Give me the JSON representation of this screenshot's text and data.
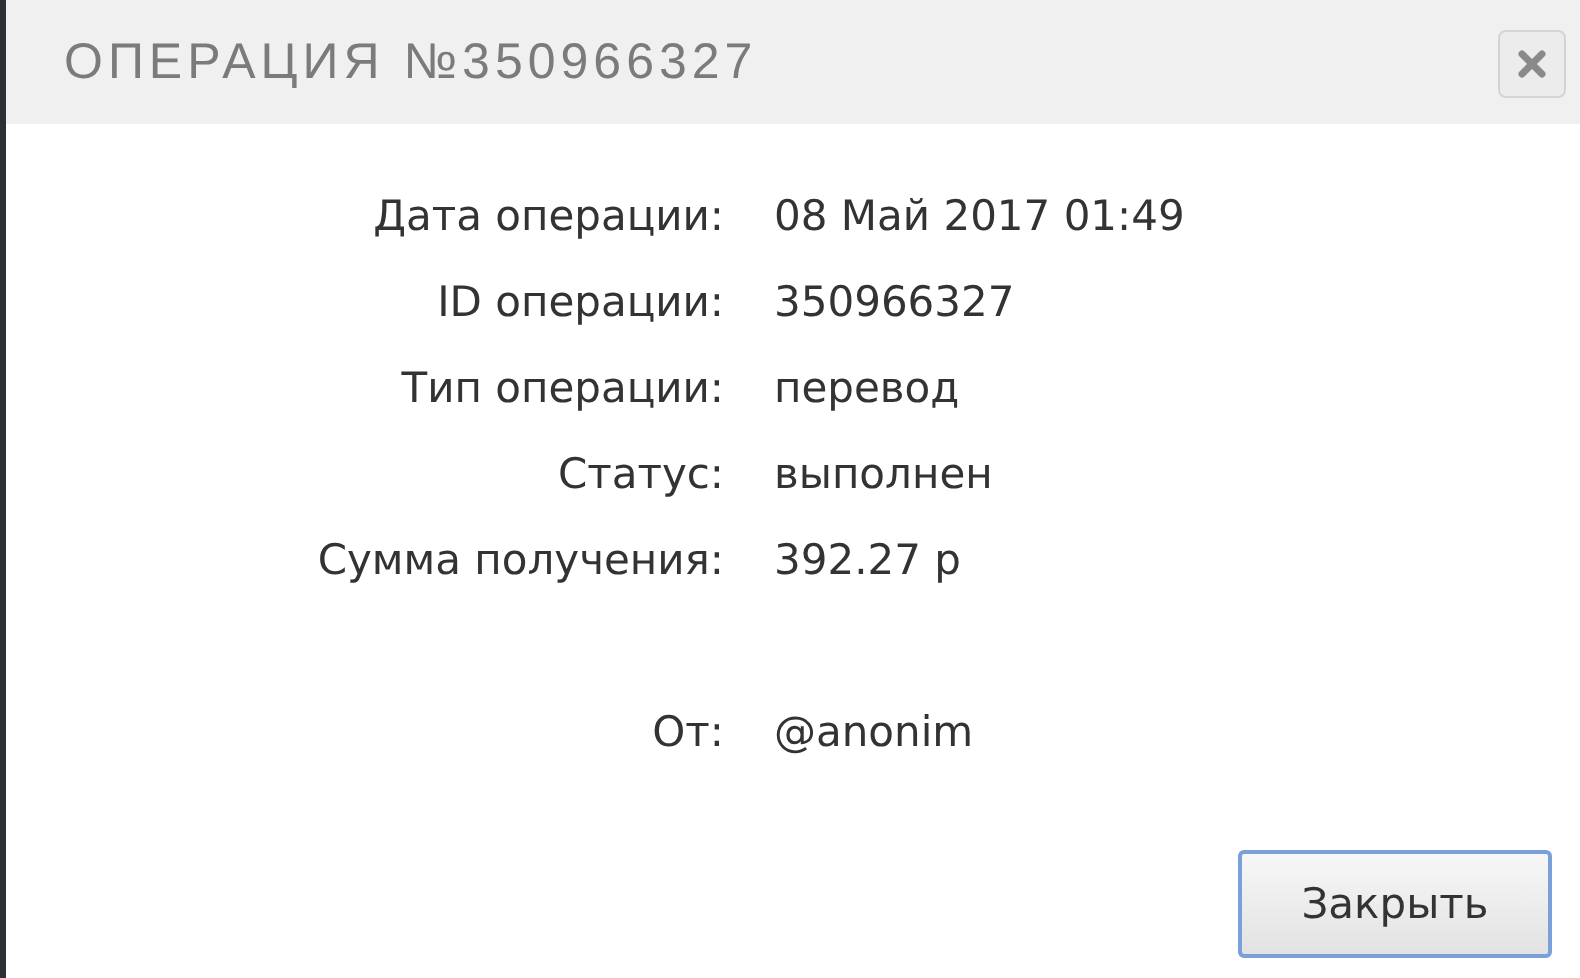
{
  "dialog": {
    "title": "ОПЕРАЦИЯ №350966327"
  },
  "details": [
    {
      "kind": "field",
      "label": "Дата операции:",
      "value": "08 Май 2017 01:49"
    },
    {
      "kind": "field",
      "label": "ID операции:",
      "value": "350966327"
    },
    {
      "kind": "field",
      "label": "Тип операции:",
      "value": "перевод"
    },
    {
      "kind": "field",
      "label": "Статус:",
      "value": "выполнен"
    },
    {
      "kind": "field",
      "label": "Сумма получения:",
      "value": "392.27 р"
    },
    {
      "kind": "separated",
      "label": "От:",
      "value": "@anonim"
    }
  ],
  "buttons": [
    {
      "label": "Закрыть",
      "focused": true
    }
  ]
}
